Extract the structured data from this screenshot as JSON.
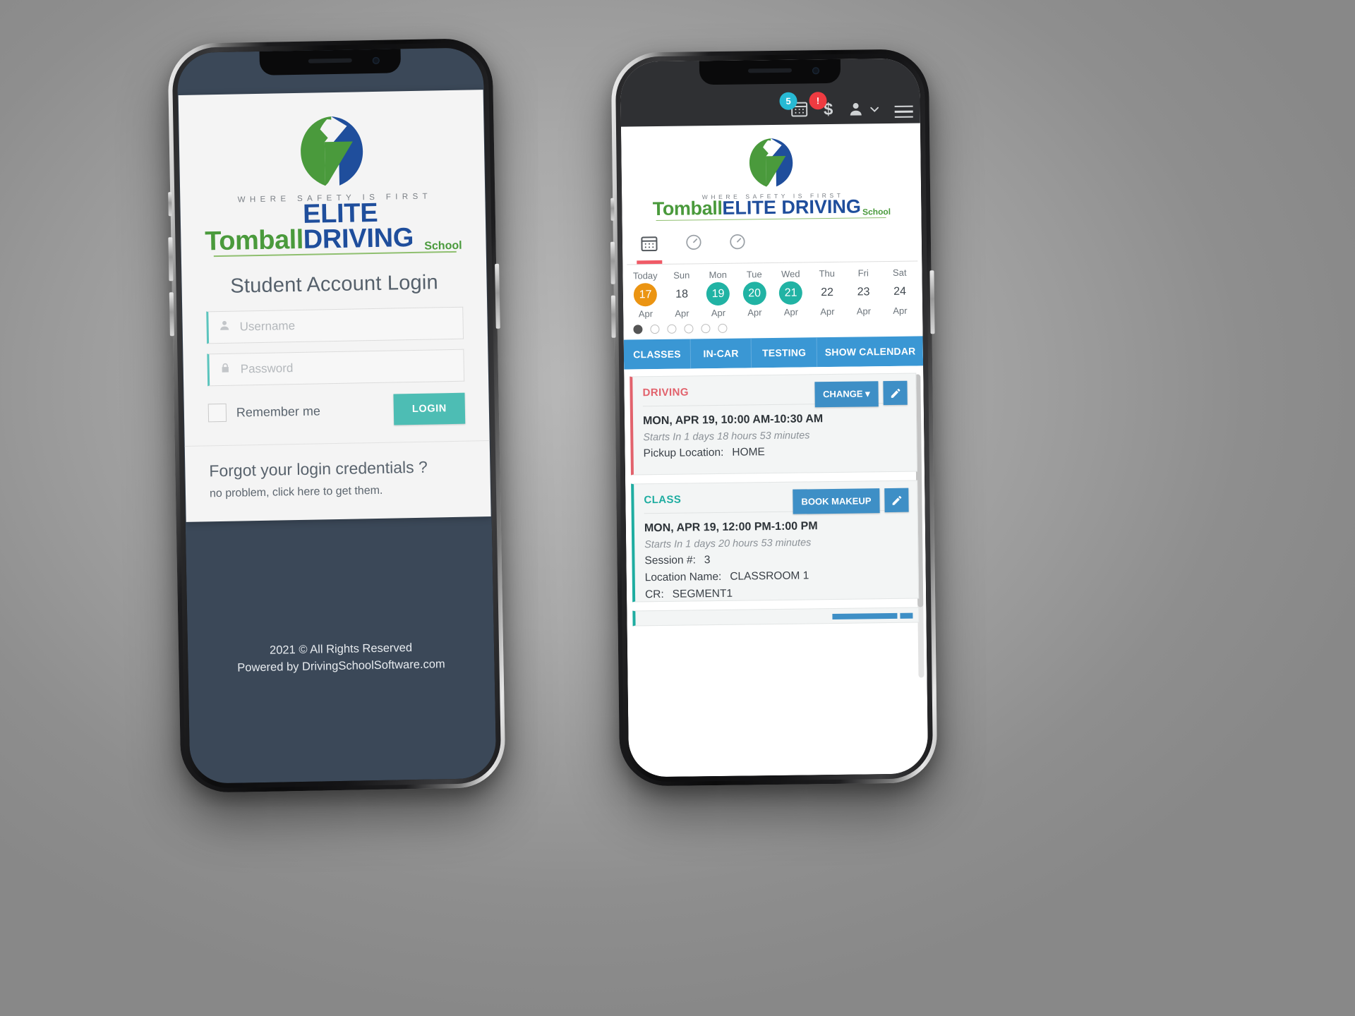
{
  "brand": {
    "tagline": "WHERE SAFETY IS FIRST",
    "name_part1": "Tomball",
    "name_part2": "ELITE DRIVING",
    "name_part3": "School",
    "green": "#4a9a3c",
    "blue": "#1f4e9c"
  },
  "login": {
    "title": "Student Account Login",
    "username_placeholder": "Username",
    "username_value": "",
    "password_placeholder": "Password",
    "password_value": "",
    "remember_label": "Remember me",
    "login_button": "LOGIN",
    "forgot_heading": "Forgot your login credentials ?",
    "forgot_sub": "no problem, click here to get them.",
    "footer_line1": "2021 © All Rights Reserved",
    "footer_line2": "Powered by DrivingSchoolSoftware.com",
    "accent_field": "#5bc4bd",
    "accent_button": "#4dbdb4",
    "screen_bg": "#3b4858"
  },
  "dashboard": {
    "topbar": {
      "calendar_icon": "calendar-icon",
      "calendar_badge": "5",
      "calendar_badge_color": "#27b9d4",
      "money_icon": "dollar-sign-icon",
      "money_badge": "!",
      "money_badge_color": "#ef3b41",
      "user_icon": "user-icon",
      "chevron_icon": "chevron-down-icon",
      "menu_icon": "hamburger-menu-icon"
    },
    "tab_icons": [
      {
        "name": "calendar-icon",
        "active": true
      },
      {
        "name": "gauge-icon",
        "active": false
      },
      {
        "name": "gauge-icon",
        "active": false
      }
    ],
    "days": [
      {
        "weekday": "Today",
        "num": "17",
        "month": "Apr",
        "style": "orange"
      },
      {
        "weekday": "Sun",
        "num": "18",
        "month": "Apr",
        "style": "plain"
      },
      {
        "weekday": "Mon",
        "num": "19",
        "month": "Apr",
        "style": "teal"
      },
      {
        "weekday": "Tue",
        "num": "20",
        "month": "Apr",
        "style": "teal"
      },
      {
        "weekday": "Wed",
        "num": "21",
        "month": "Apr",
        "style": "teal"
      },
      {
        "weekday": "Thu",
        "num": "22",
        "month": "Apr",
        "style": "plain"
      },
      {
        "weekday": "Fri",
        "num": "23",
        "month": "Apr",
        "style": "plain"
      },
      {
        "weekday": "Sat",
        "num": "24",
        "month": "Apr",
        "style": "plain"
      }
    ],
    "pager_dots": 6,
    "pager_active_index": 0,
    "tabs": [
      {
        "label": "CLASSES"
      },
      {
        "label": "IN-CAR"
      },
      {
        "label": "TESTING"
      },
      {
        "label": "SHOW CALENDAR"
      }
    ],
    "tabs_color": "#3a97d4",
    "cards": [
      {
        "type": "DRIVING",
        "accent": "#e2626c",
        "action_label": "CHANGE",
        "action_has_caret": true,
        "edit_icon": "pencil-icon",
        "when": "MON, APR 19, 10:00 AM-10:30 AM",
        "starts_in": "Starts In 1 days 18 hours 53 minutes",
        "fields": [
          {
            "label": "Pickup Location:",
            "value": "HOME"
          }
        ]
      },
      {
        "type": "CLASS",
        "accent": "#1fada1",
        "action_label": "BOOK MAKEUP",
        "action_has_caret": false,
        "edit_icon": "pencil-icon",
        "when": "MON, APR 19, 12:00 PM-1:00 PM",
        "starts_in": "Starts In 1 days 20 hours 53 minutes",
        "fields": [
          {
            "label": "Session #:",
            "value": "3"
          },
          {
            "label": "Location Name:",
            "value": "CLASSROOM 1"
          },
          {
            "label": "CR:",
            "value": "SEGMENT1"
          }
        ]
      }
    ]
  }
}
